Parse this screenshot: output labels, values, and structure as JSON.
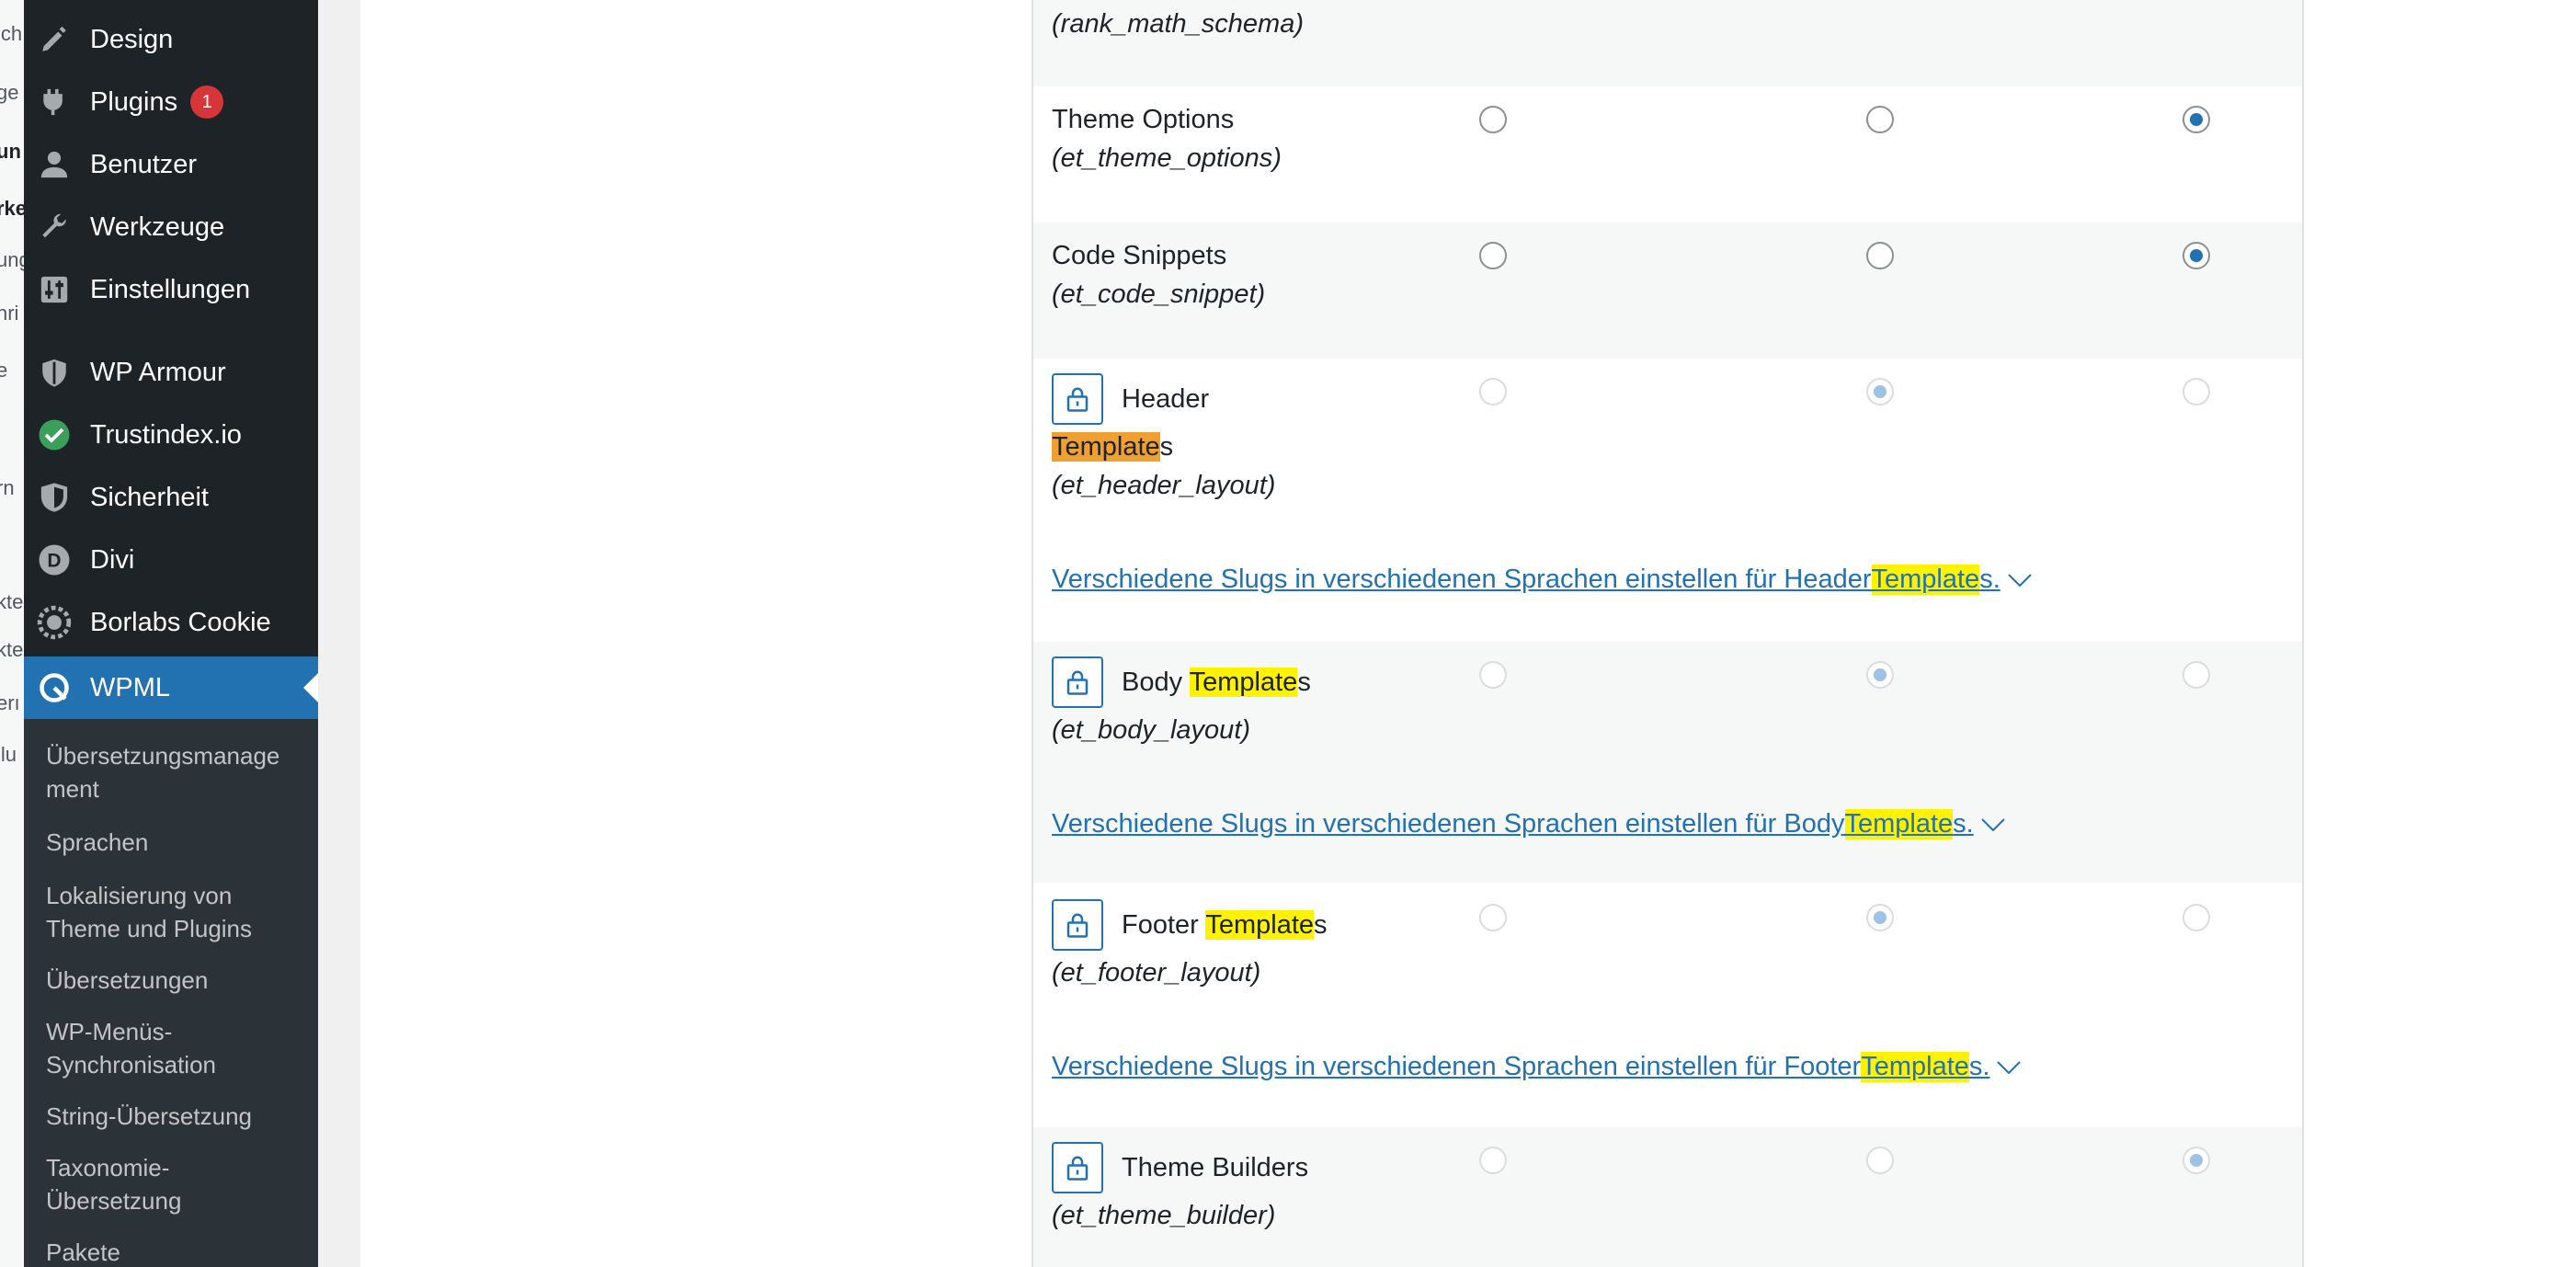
{
  "left_strip": [
    "ich",
    "ge",
    "un",
    "rke",
    "ung",
    "hri",
    "e",
    "rn",
    "kte",
    "kte",
    "erı",
    "llu"
  ],
  "sidebar": {
    "items": [
      {
        "label": "Design",
        "icon": "brush-icon"
      },
      {
        "label": "Plugins",
        "icon": "plugin-icon",
        "badge": "1"
      },
      {
        "label": "Benutzer",
        "icon": "user-icon"
      },
      {
        "label": "Werkzeuge",
        "icon": "wrench-icon"
      },
      {
        "label": "Einstellungen",
        "icon": "settings-sliders-icon"
      },
      {
        "label": "WP Armour",
        "icon": "shield-icon"
      },
      {
        "label": "Trustindex.io",
        "icon": "check-circle-icon"
      },
      {
        "label": "Sicherheit",
        "icon": "security-shield-icon"
      },
      {
        "label": "Divi",
        "icon": "divi-logo-icon"
      },
      {
        "label": "Borlabs Cookie",
        "icon": "cookie-icon"
      },
      {
        "label": "WPML",
        "icon": "wpml-icon",
        "active": true
      }
    ],
    "submenu": [
      "Übersetzungsmanage\nment",
      "Sprachen",
      "Lokalisierung von\nTheme und Plugins",
      "Übersetzungen",
      "WP-Menüs-\nSynchronisation",
      "String-Übersetzung",
      "Taxonomie-\nÜbersetzung",
      "Pakete"
    ]
  },
  "table": {
    "rows": [
      {
        "slug": "(rank_math_schema)"
      },
      {
        "name": "Theme Options",
        "slug": "(et_theme_options)",
        "selected": 3
      },
      {
        "name": "Code Snippets",
        "slug": "(et_code_snippet)",
        "selected": 3
      },
      {
        "name_prefix": "Header",
        "name_highlight": "Template",
        "name_suffix": "s",
        "slug": "(et_header_layout)",
        "selected": 2,
        "link_prefix": "Verschiedene Slugs in verschiedenen Sprachen einstellen für Header ",
        "link_highlight": "Template",
        "link_suffix": "s."
      },
      {
        "name_prefix": "Body ",
        "name_highlight": "Template",
        "name_suffix": "s",
        "slug": "(et_body_layout)",
        "selected": 2,
        "link_prefix": "Verschiedene Slugs in verschiedenen Sprachen einstellen für Body ",
        "link_highlight": "Template",
        "link_suffix": "s."
      },
      {
        "name_prefix": "Footer ",
        "name_highlight": "Template",
        "name_suffix": "s",
        "slug": "(et_footer_layout)",
        "selected": 2,
        "link_prefix": "Verschiedene Slugs in verschiedenen Sprachen einstellen für Footer ",
        "link_highlight": "Template",
        "link_suffix": "s."
      },
      {
        "name": "Theme Builders",
        "slug": "(et_theme_builder)",
        "selected": 3
      }
    ]
  },
  "colors": {
    "accent": "#2271b1",
    "highlight_current": "#f0a030",
    "highlight": "#fff200",
    "badge": "#d63638"
  }
}
